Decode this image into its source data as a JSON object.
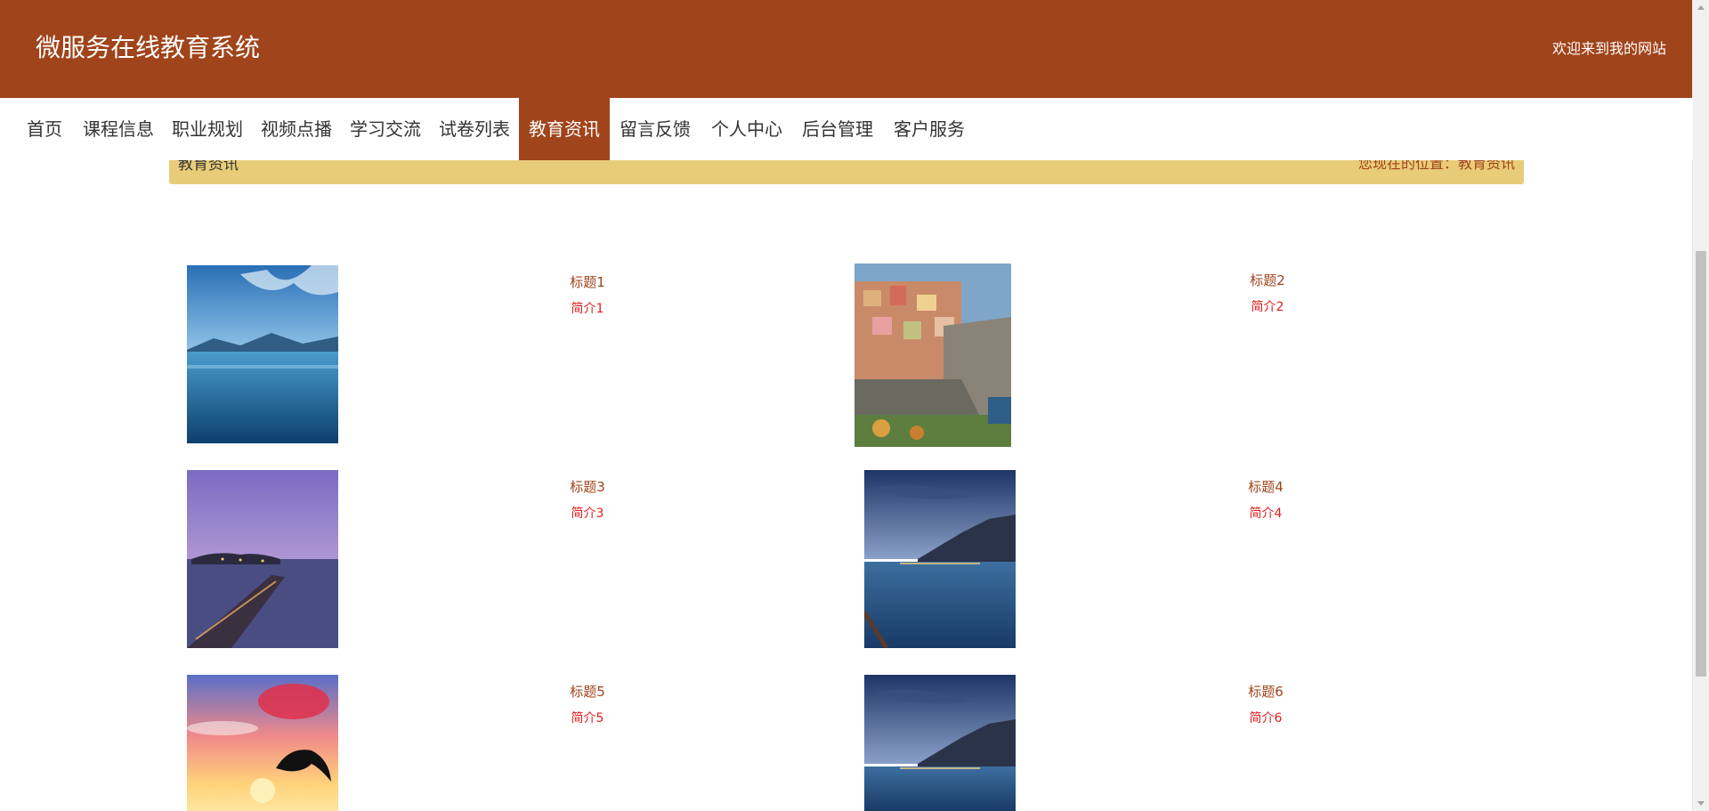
{
  "header": {
    "site_title": "微服务在线教育系统",
    "welcome": "欢迎来到我的网站"
  },
  "nav": {
    "items": [
      {
        "label": "首页"
      },
      {
        "label": "课程信息"
      },
      {
        "label": "职业规划"
      },
      {
        "label": "视频点播"
      },
      {
        "label": "学习交流"
      },
      {
        "label": "试卷列表"
      },
      {
        "label": "教育资讯",
        "active": true
      },
      {
        "label": "留言反馈"
      },
      {
        "label": "个人中心"
      },
      {
        "label": "后台管理"
      },
      {
        "label": "客户服务"
      }
    ]
  },
  "breadcrumb": {
    "title": "教育资讯",
    "path": "您现在的位置：教育资讯"
  },
  "news": [
    {
      "title": "标题1",
      "intro": "简介1",
      "image": "lake-clouds-photo"
    },
    {
      "title": "标题2",
      "intro": "简介2",
      "image": "cliff-village-photo"
    },
    {
      "title": "标题3",
      "intro": "简介3",
      "image": "pier-sunset-photo"
    },
    {
      "title": "标题4",
      "intro": "简介4",
      "image": "lake-town-night-photo"
    },
    {
      "title": "标题5",
      "intro": "简介5",
      "image": "dolphin-sunset-photo"
    },
    {
      "title": "标题6",
      "intro": "简介6",
      "image": "lake-town-night-photo"
    }
  ],
  "colors": {
    "brand": "#a0441b",
    "breadcrumb_bg": "#e8cc78",
    "intro_text": "#e02020"
  }
}
